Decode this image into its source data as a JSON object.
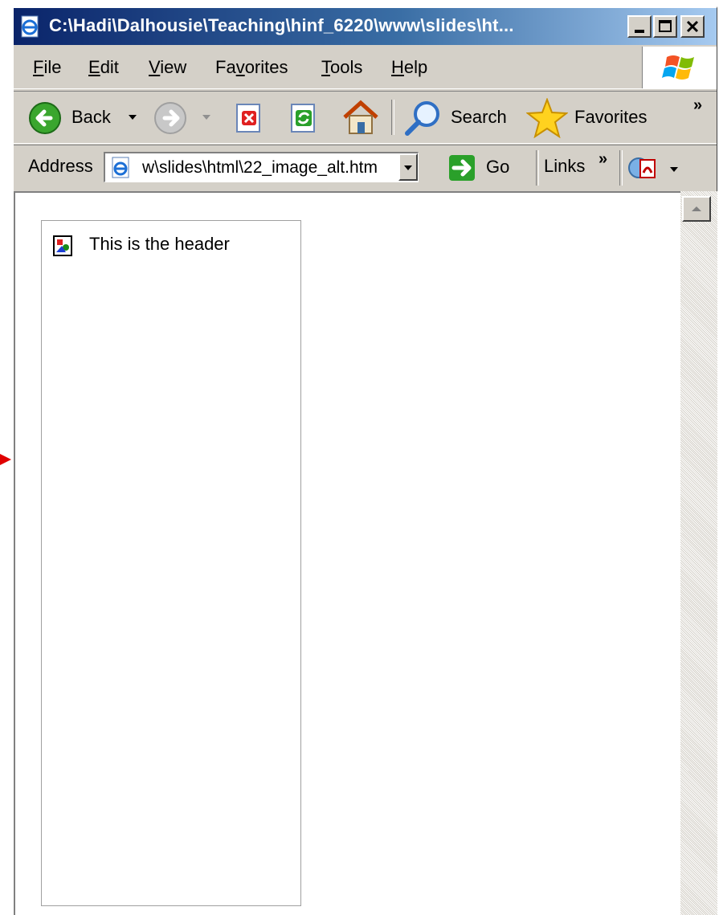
{
  "window": {
    "title": "C:\\Hadi\\Dalhousie\\Teaching\\hinf_6220\\www\\slides\\ht...",
    "minimize_label": "_",
    "maximize_label": "□",
    "close_label": "✕"
  },
  "menu": {
    "items": [
      "File",
      "Edit",
      "View",
      "Favorites",
      "Tools",
      "Help"
    ],
    "mnemonics": [
      "F",
      "E",
      "V",
      "v",
      "T",
      "H"
    ]
  },
  "toolbar": {
    "back_label": "Back",
    "search_label": "Search",
    "favorites_label": "Favorites",
    "chevron_label": "»"
  },
  "address": {
    "label": "Address",
    "value": "w\\slides\\html\\22_image_alt.htm",
    "go_label": "Go",
    "links_label": "Links",
    "links_chevron": "»"
  },
  "page": {
    "image_alt_text": "This is the header"
  },
  "colors": {
    "title_gradient_start": "#0a246a",
    "chrome_bg": "#d4d0c8",
    "arrow_marker": "#e00000"
  }
}
